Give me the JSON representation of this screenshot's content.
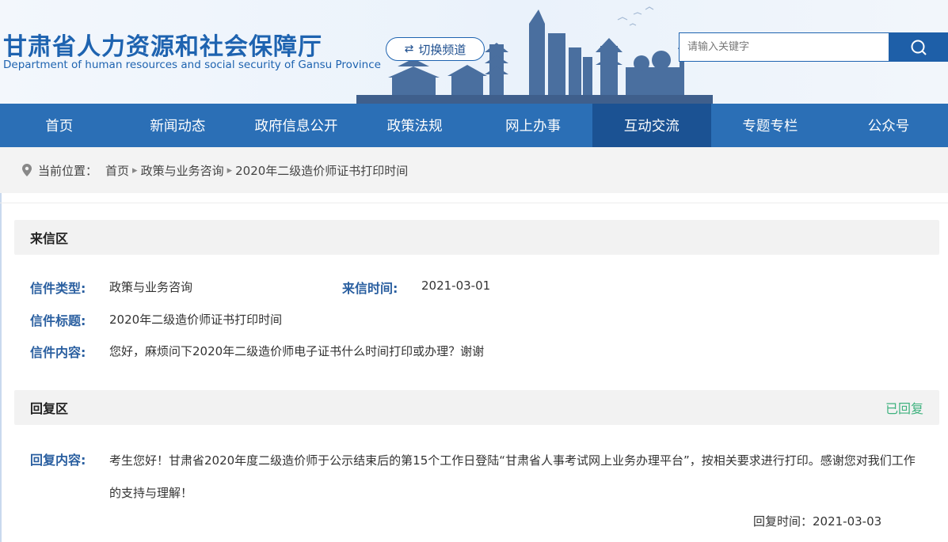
{
  "header": {
    "title": "甘肃省人力资源和社会保障厅",
    "subtitle": "Department of human resources and social security of Gansu Province",
    "switch_label": "切换频道",
    "search_placeholder": "请输入关键字"
  },
  "nav": {
    "items": [
      {
        "label": "首页"
      },
      {
        "label": "新闻动态"
      },
      {
        "label": "政府信息公开"
      },
      {
        "label": "政策法规"
      },
      {
        "label": "网上办事"
      },
      {
        "label": "互动交流"
      },
      {
        "label": "专题专栏"
      },
      {
        "label": "公众号"
      }
    ],
    "active_index": 5
  },
  "breadcrumb": {
    "prefix": "当前位置：",
    "items": [
      "首页",
      "政策与业务咨询",
      "2020年二级造价师证书打印时间"
    ]
  },
  "letter": {
    "section_title": "来信区",
    "type_label": "信件类型:",
    "type_value": "政策与业务咨询",
    "time_label": "来信时间:",
    "time_value": "2021-03-01",
    "subject_label": "信件标题:",
    "subject_value": "2020年二级造价师证书打印时间",
    "content_label": "信件内容:",
    "content_value": "您好，麻烦问下2020年二级造价师电子证书什么时间打印或办理？谢谢"
  },
  "reply": {
    "section_title": "回复区",
    "status": "已回复",
    "content_label": "回复内容:",
    "content_value": "考生您好！甘肃省2020年度二级造价师于公示结束后的第15个工作日登陆“甘肃省人事考试网上业务办理平台”，按相关要求进行打印。感谢您对我们工作的支持与理解！",
    "time_text": "回复时间：2021-03-03"
  },
  "colors": {
    "brand_blue": "#2b6fb6",
    "nav_active": "#1b5293",
    "label_blue": "#2a5fa0",
    "status_green": "#3fb27f"
  }
}
